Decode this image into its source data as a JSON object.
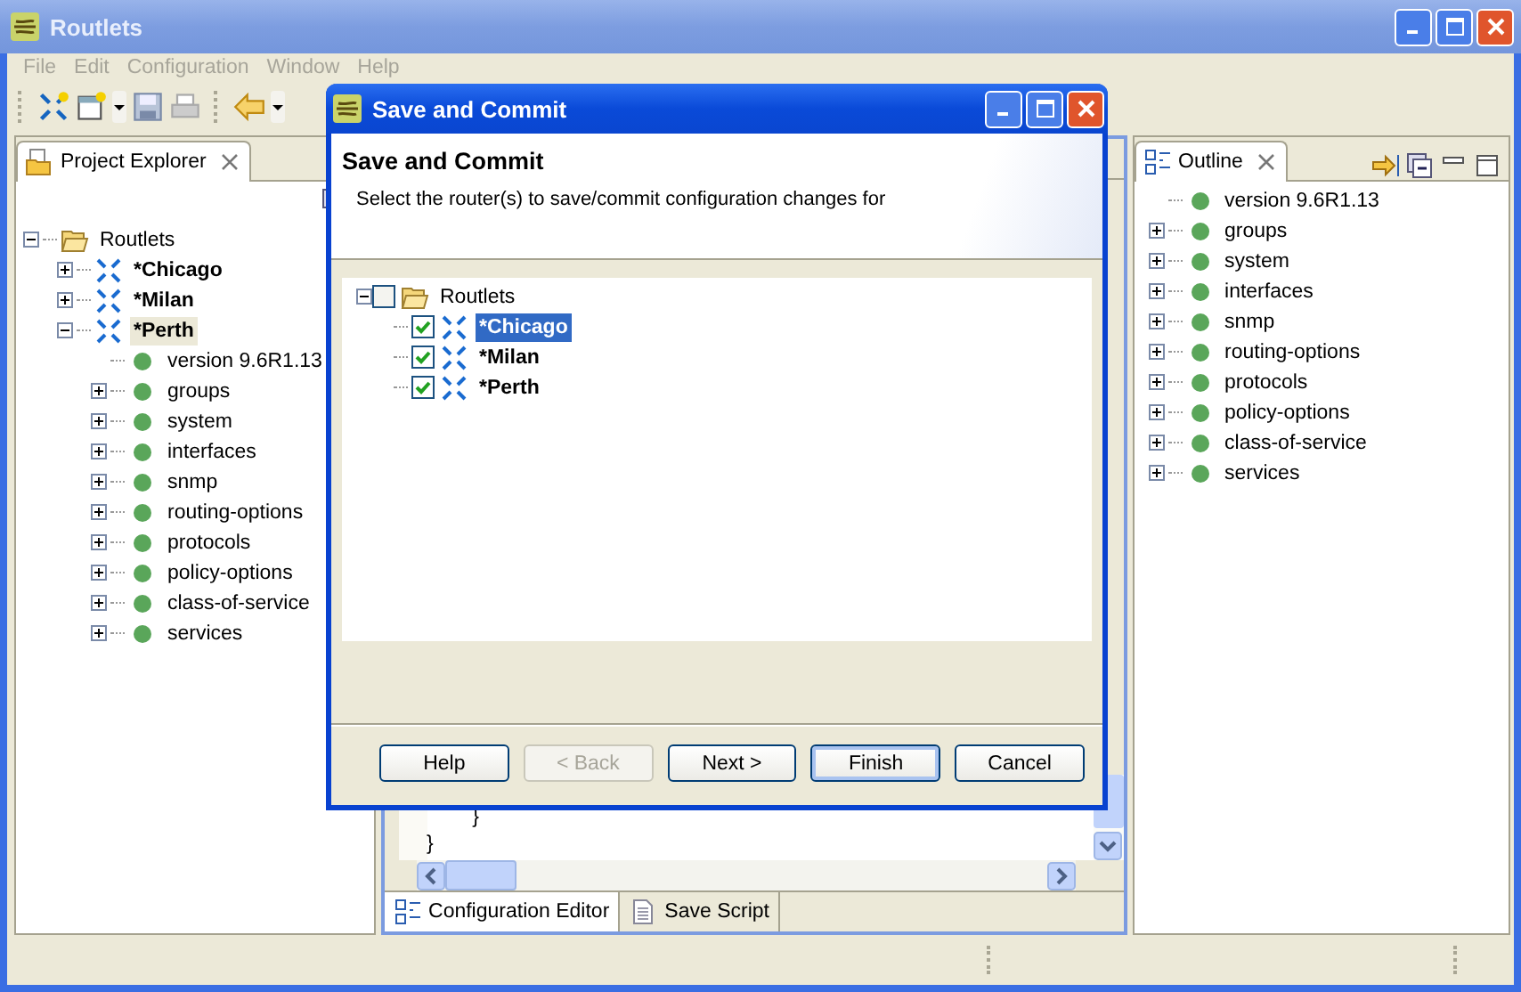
{
  "window": {
    "title": "Routlets"
  },
  "menu": [
    "File",
    "Edit",
    "Configuration",
    "Window",
    "Help"
  ],
  "explorer": {
    "title": "Project Explorer",
    "tree": [
      {
        "label": "Routlets",
        "kind": "folder",
        "expanded": true,
        "selected": false,
        "children": [
          {
            "label": "*Chicago",
            "kind": "router",
            "expanded": false,
            "selected": false
          },
          {
            "label": "*Milan",
            "kind": "router",
            "expanded": false,
            "selected": false
          },
          {
            "label": "*Perth",
            "kind": "router",
            "expanded": true,
            "selected": true,
            "children": [
              {
                "label": "version 9.6R1.13",
                "kind": "element",
                "selected": false
              },
              {
                "label": "groups",
                "kind": "element",
                "expanded": false,
                "selected": false
              },
              {
                "label": "system",
                "kind": "element",
                "expanded": false,
                "selected": false
              },
              {
                "label": "interfaces",
                "kind": "element",
                "expanded": false,
                "selected": false
              },
              {
                "label": "snmp",
                "kind": "element",
                "expanded": false,
                "selected": false
              },
              {
                "label": "routing-options",
                "kind": "element",
                "expanded": false,
                "selected": false
              },
              {
                "label": "protocols",
                "kind": "element",
                "expanded": false,
                "selected": false
              },
              {
                "label": "policy-options",
                "kind": "element",
                "expanded": false,
                "selected": false
              },
              {
                "label": "class-of-service",
                "kind": "element",
                "expanded": false,
                "selected": false
              },
              {
                "label": "services",
                "kind": "element",
                "expanded": false,
                "selected": false
              }
            ]
          }
        ]
      }
    ]
  },
  "editor": {
    "lines": [
      "        }",
      "}"
    ],
    "tabs": [
      {
        "label": "Configuration Editor",
        "selected": true
      },
      {
        "label": "Save Script",
        "selected": false
      }
    ]
  },
  "outline": {
    "title": "Outline",
    "tree": [
      {
        "label": "version 9.6R1.13",
        "kind": "element",
        "selected": false
      },
      {
        "label": "groups",
        "kind": "element",
        "expanded": false,
        "selected": false
      },
      {
        "label": "system",
        "kind": "element",
        "expanded": false,
        "selected": false
      },
      {
        "label": "interfaces",
        "kind": "element",
        "expanded": false,
        "selected": false
      },
      {
        "label": "snmp",
        "kind": "element",
        "expanded": false,
        "selected": false
      },
      {
        "label": "routing-options",
        "kind": "element",
        "expanded": false,
        "selected": false
      },
      {
        "label": "protocols",
        "kind": "element",
        "expanded": false,
        "selected": false
      },
      {
        "label": "policy-options",
        "kind": "element",
        "expanded": false,
        "selected": false
      },
      {
        "label": "class-of-service",
        "kind": "element",
        "expanded": false,
        "selected": false
      },
      {
        "label": "services",
        "kind": "element",
        "expanded": false,
        "selected": false
      }
    ]
  },
  "dialog": {
    "title": "Save and Commit",
    "heading": "Save and Commit",
    "description": "Select the router(s) to save/commit configuration changes for",
    "tree": [
      {
        "label": "Routlets",
        "kind": "folder",
        "expanded": true,
        "checked": false,
        "selected": false,
        "children": [
          {
            "label": "*Chicago",
            "kind": "router",
            "checked": true,
            "selected": true
          },
          {
            "label": "*Milan",
            "kind": "router",
            "checked": true,
            "selected": false
          },
          {
            "label": "*Perth",
            "kind": "router",
            "checked": true,
            "selected": false
          }
        ]
      }
    ],
    "buttons": [
      {
        "label": "Help",
        "disabled": false,
        "default": false
      },
      {
        "label": "< Back",
        "disabled": true,
        "default": false
      },
      {
        "label": "Next >",
        "disabled": false,
        "default": false
      },
      {
        "label": "Finish",
        "disabled": false,
        "default": true
      },
      {
        "label": "Cancel",
        "disabled": false,
        "default": false
      }
    ]
  }
}
